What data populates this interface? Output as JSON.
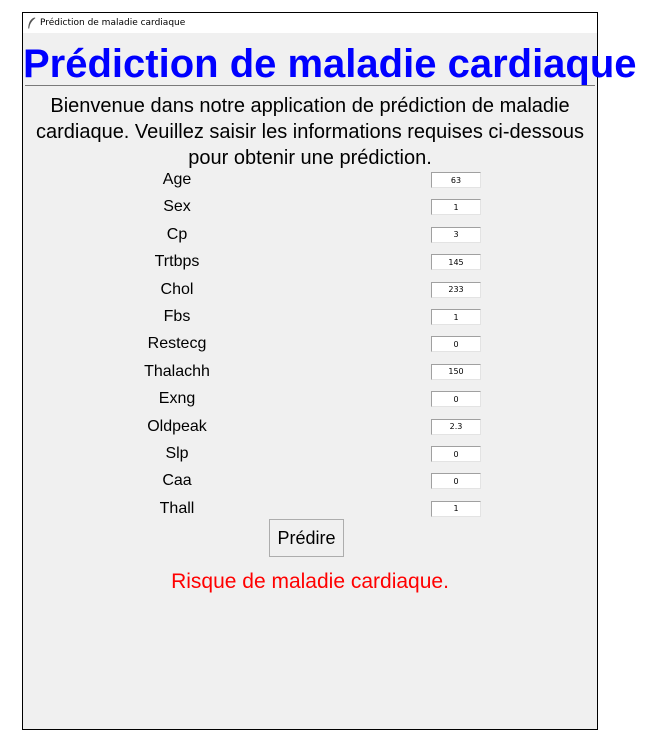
{
  "window": {
    "title": "Prédiction de maladie cardiaque"
  },
  "header": {
    "title": "Prédiction de maladie cardiaque"
  },
  "intro": [
    "Bienvenue dans notre application de prédiction de maladie",
    "cardiaque. Veuillez saisir les informations requises ci-dessous",
    "pour obtenir une prédiction."
  ],
  "fields": [
    {
      "label": "Age",
      "value": "63"
    },
    {
      "label": "Sex",
      "value": "1"
    },
    {
      "label": "Cp",
      "value": "3"
    },
    {
      "label": "Trtbps",
      "value": "145"
    },
    {
      "label": "Chol",
      "value": "233"
    },
    {
      "label": "Fbs",
      "value": "1"
    },
    {
      "label": "Restecg",
      "value": "0"
    },
    {
      "label": "Thalachh",
      "value": "150"
    },
    {
      "label": "Exng",
      "value": "0"
    },
    {
      "label": "Oldpeak",
      "value": "2.3"
    },
    {
      "label": "Slp",
      "value": "0"
    },
    {
      "label": "Caa",
      "value": "0"
    },
    {
      "label": "Thall",
      "value": "1"
    }
  ],
  "actions": {
    "predict_label": "Prédire"
  },
  "result": {
    "text": "Risque de maladie cardiaque.",
    "color": "#ff0000"
  },
  "colors": {
    "heading": "#0000ff",
    "window_bg": "#f0f0f0"
  },
  "icons": {
    "window_icon": "feather-icon"
  }
}
